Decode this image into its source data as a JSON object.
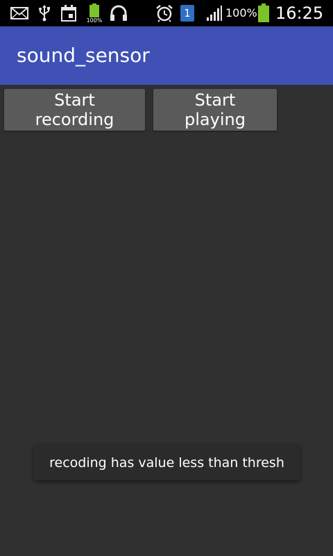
{
  "status_bar": {
    "battery_percent_text": "100%",
    "time": "16:25",
    "notification_badge": "1",
    "small_battery_label": "100%",
    "icons": [
      "mail-icon",
      "usb-icon",
      "calendar-icon",
      "battery-small-icon",
      "headphones-icon",
      "alarm-icon",
      "notification-badge-icon",
      "signal-icon",
      "battery-icon"
    ],
    "battery_color": "#7cc22b"
  },
  "app_bar": {
    "title": "sound_sensor",
    "color": "#3f51b5"
  },
  "buttons": {
    "start_recording": "Start recording",
    "start_playing": "Start playing"
  },
  "toast": {
    "message": "recoding has value less than thresh"
  }
}
